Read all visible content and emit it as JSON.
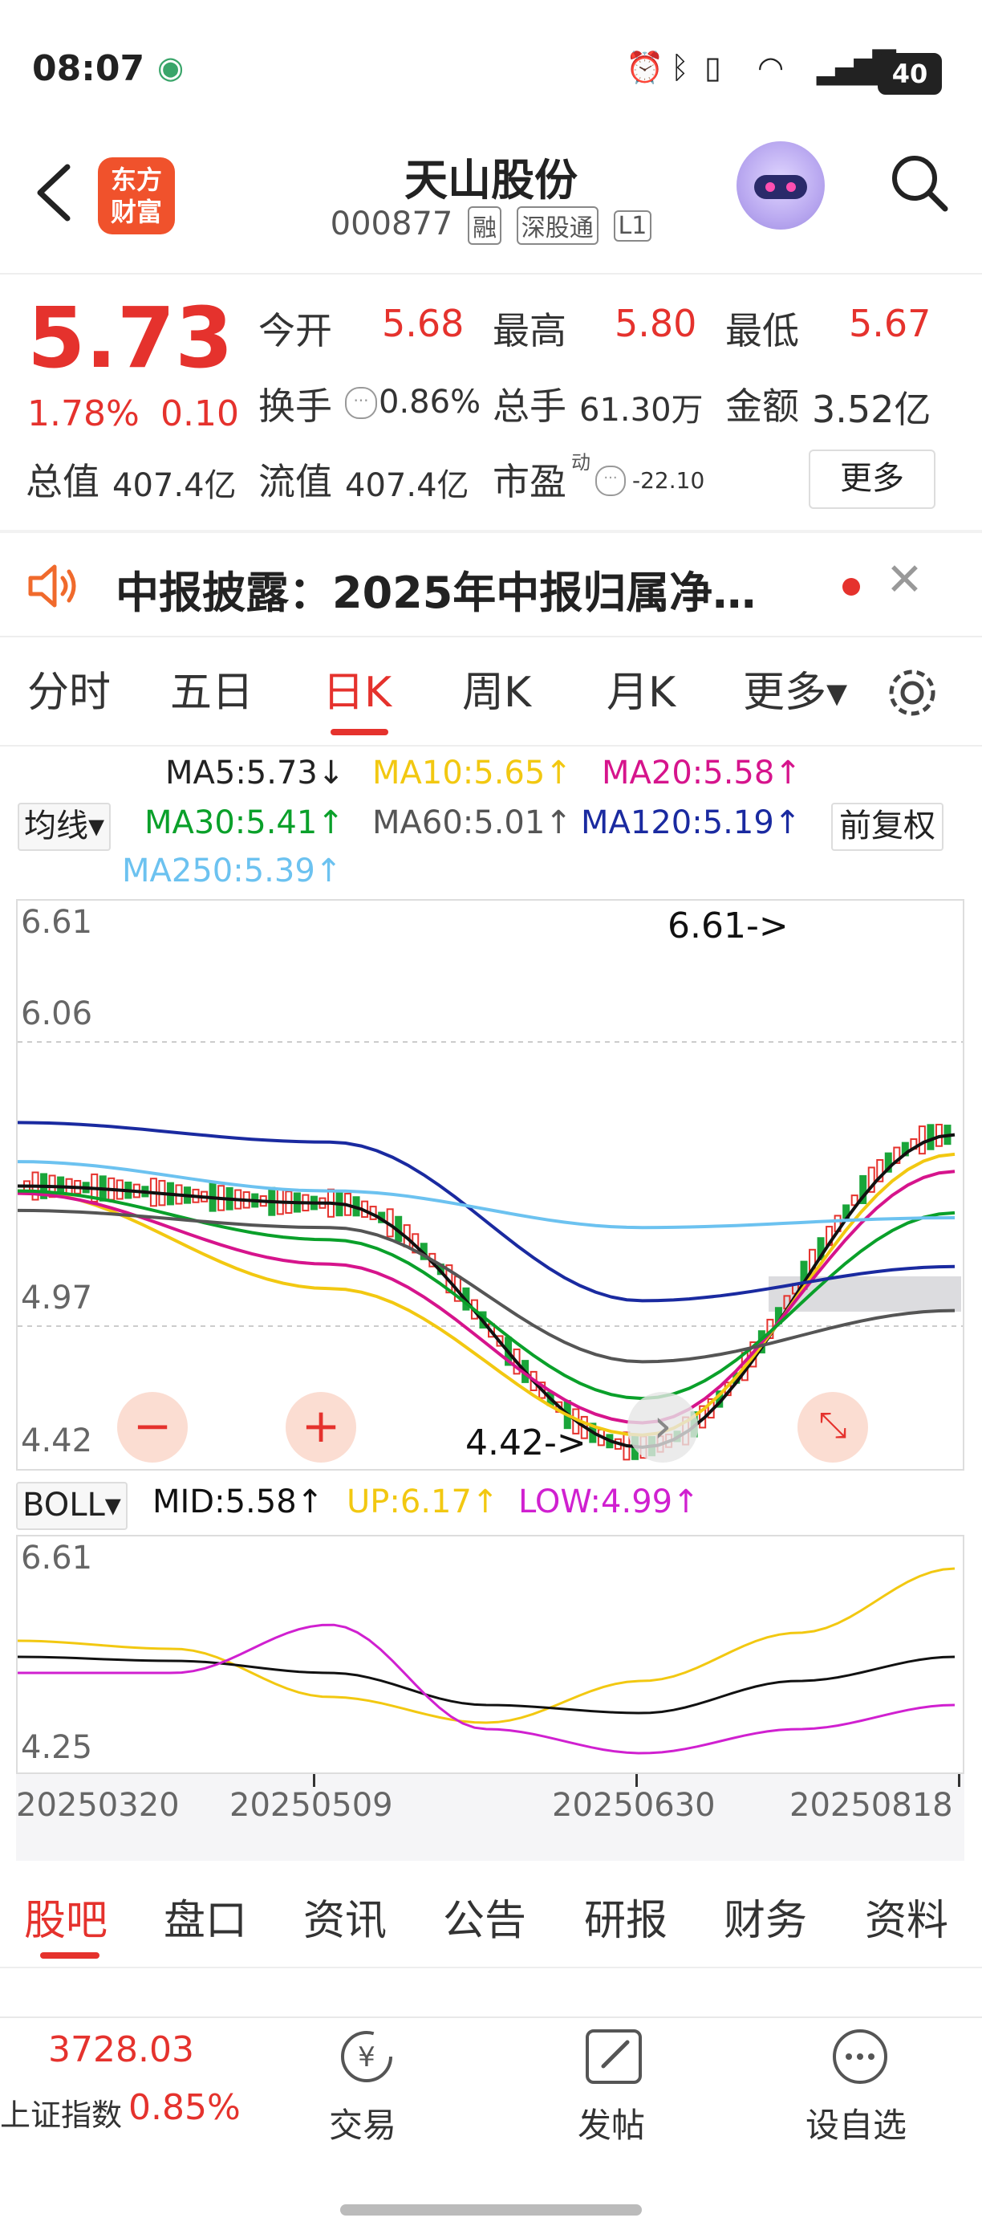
{
  "status_bar": {
    "time": "08:07",
    "battery": "40"
  },
  "header": {
    "logo_text_line1": "东方",
    "logo_text_line2": "财富",
    "title": "天山股份",
    "code": "000877",
    "tags": [
      "融",
      "深股通",
      "L1"
    ]
  },
  "quote": {
    "price": "5.73",
    "change_pct": "1.78%",
    "change_amt": "0.10",
    "open_label": "今开",
    "open": "5.68",
    "high_label": "最高",
    "high": "5.80",
    "low_label": "最低",
    "low": "5.67",
    "turnover_label": "换手",
    "turnover": "0.86%",
    "volume_label": "总手",
    "volume": "61.30万",
    "amount_label": "金额",
    "amount": "3.52亿",
    "mktcap_label": "总值",
    "mktcap": "407.4亿",
    "float_label": "流值",
    "float_cap": "407.4亿",
    "pe_label": "市盈",
    "pe_sup": "动",
    "pe": "-22.10",
    "more_label": "更多"
  },
  "news": {
    "text": "中报披露：2025年中报归属净…"
  },
  "chart_tabs": [
    {
      "label": "分时"
    },
    {
      "label": "五日"
    },
    {
      "label": "日K"
    },
    {
      "label": "周K"
    },
    {
      "label": "月K"
    },
    {
      "label": "更多▾"
    }
  ],
  "ma_legend": {
    "selector": "均线▾",
    "fq": "前复权",
    "items": [
      {
        "text": "MA5:5.73↓",
        "color": "#111111"
      },
      {
        "text": "MA10:5.65↑",
        "color": "#f2c811"
      },
      {
        "text": "MA20:5.58↑",
        "color": "#d6148c"
      },
      {
        "text": "MA30:5.41↑",
        "color": "#0aa02a"
      },
      {
        "text": "MA60:5.01↑",
        "color": "#555555"
      },
      {
        "text": "MA120:5.19↑",
        "color": "#1a2aa0"
      },
      {
        "text": "MA250:5.39↑",
        "color": "#6cc2f0"
      }
    ]
  },
  "boll_legend": {
    "selector": "BOLL▾",
    "items": [
      {
        "text": "MID:5.58↑",
        "color": "#111111"
      },
      {
        "text": "UP:6.17↑",
        "color": "#f2c811"
      },
      {
        "text": "LOW:4.99↑",
        "color": "#d020d0"
      }
    ]
  },
  "chart_labels": {
    "y_top": "6.61",
    "y_mid": "6.06",
    "y_low": "4.97",
    "y_bottom": "4.42",
    "max_mark": "6.61->",
    "min_mark": "4.42->",
    "boll_top": "6.61",
    "boll_bottom": "4.25",
    "dates": [
      "20250320",
      "20250509",
      "20250630",
      "20250818"
    ]
  },
  "chart_data": {
    "type": "line",
    "x": [
      "20250320",
      "20250509",
      "20250630",
      "20250818"
    ],
    "ylim": [
      4.42,
      6.61
    ],
    "series": [
      {
        "name": "MA5",
        "values": [
          5.52,
          5.45,
          4.45,
          5.73
        ]
      },
      {
        "name": "MA10",
        "values": [
          5.5,
          5.1,
          4.5,
          5.65
        ]
      },
      {
        "name": "MA20",
        "values": [
          5.49,
          5.2,
          4.55,
          5.58
        ]
      },
      {
        "name": "MA30",
        "values": [
          5.5,
          5.3,
          4.65,
          5.41
        ]
      },
      {
        "name": "MA60",
        "values": [
          5.42,
          5.35,
          4.8,
          5.01
        ]
      },
      {
        "name": "MA120",
        "values": [
          5.78,
          5.7,
          5.05,
          5.19
        ]
      },
      {
        "name": "MA250",
        "values": [
          5.62,
          5.5,
          5.35,
          5.39
        ]
      }
    ]
  },
  "bottom_tabs": [
    {
      "label": "股吧"
    },
    {
      "label": "盘口"
    },
    {
      "label": "资讯"
    },
    {
      "label": "公告"
    },
    {
      "label": "研报"
    },
    {
      "label": "财务"
    },
    {
      "label": "资料"
    }
  ],
  "footer": {
    "index_value": "3728.03",
    "index_name": "上证指数",
    "index_change": "0.85%",
    "trade_label": "交易",
    "post_label": "发帖",
    "watch_label": "设自选"
  }
}
